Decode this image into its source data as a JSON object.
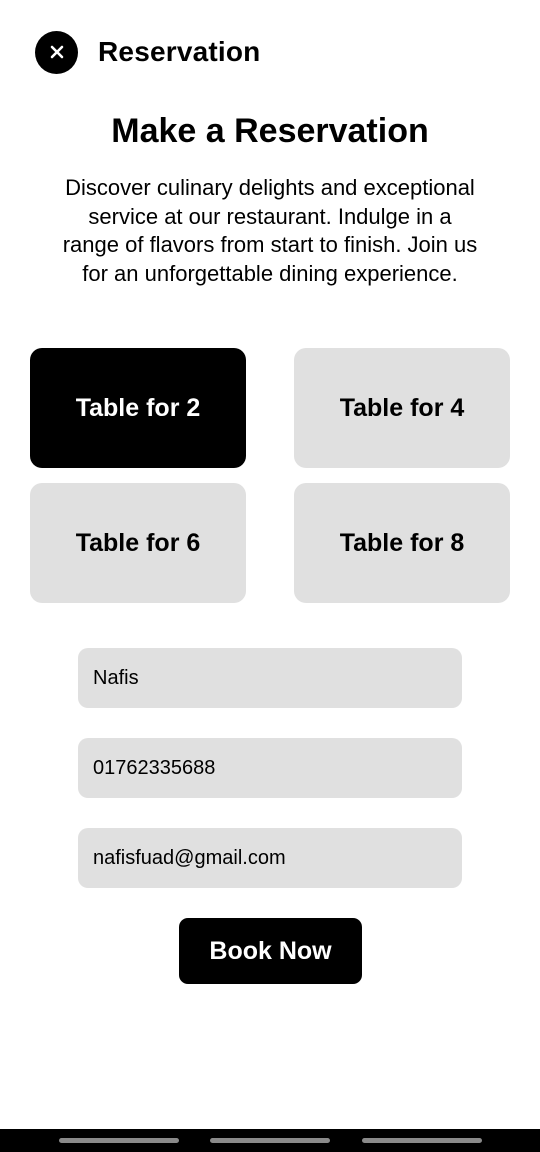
{
  "header": {
    "title": "Reservation",
    "close_icon": "close-icon"
  },
  "main": {
    "title": "Make a Reservation",
    "description": "Discover culinary delights and exceptional service at our restaurant. Indulge in a range of flavors from start to finish. Join us for an unforgettable dining experience."
  },
  "table_options": [
    {
      "label": "Table for 2",
      "selected": true
    },
    {
      "label": "Table for 4",
      "selected": false
    },
    {
      "label": "Table for 6",
      "selected": false
    },
    {
      "label": "Table for 8",
      "selected": false
    }
  ],
  "form": {
    "name": "Nafis",
    "phone": "01762335688",
    "email": "nafisfuad@gmail.com"
  },
  "book_button": {
    "label": "Book Now"
  },
  "colors": {
    "primary": "#000000",
    "secondary_bg": "#e0e0e0",
    "background": "#ffffff",
    "selected_text": "#ffffff"
  }
}
